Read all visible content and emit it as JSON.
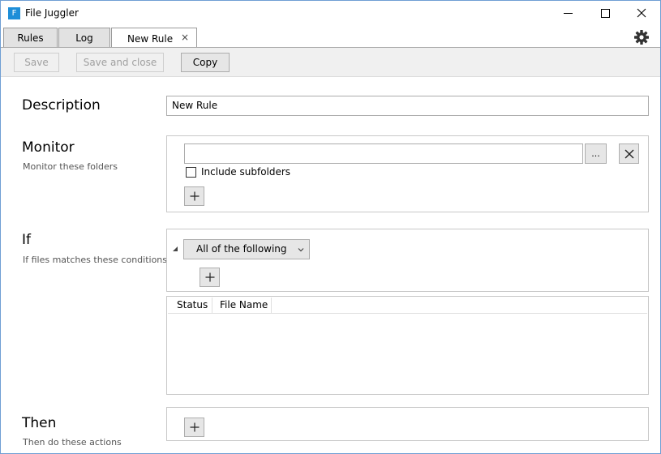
{
  "window": {
    "title": "File Juggler",
    "icon_letter": "F",
    "brand_color": "#1e8ed8"
  },
  "tabs": [
    {
      "label": "Rules"
    },
    {
      "label": "Log"
    },
    {
      "label": "New Rule",
      "close": "×"
    }
  ],
  "toolbar": {
    "save_label": "Save",
    "save_close_label": "Save and close",
    "copy_label": "Copy"
  },
  "description": {
    "title": "Description",
    "value": "New Rule"
  },
  "monitor": {
    "title": "Monitor",
    "subtitle": "Monitor these folders",
    "folder_value": "",
    "browse_label": "...",
    "include_subfolders_label": "Include subfolders",
    "include_subfolders_checked": false
  },
  "if": {
    "title": "If",
    "subtitle": "If files matches these conditions",
    "match_mode": "All of the following",
    "table_columns": [
      "Status",
      "File Name"
    ]
  },
  "then": {
    "title": "Then",
    "subtitle": "Then do these actions"
  },
  "icons": {
    "plus": "+",
    "gear": "gear-icon",
    "close": "close-icon"
  }
}
